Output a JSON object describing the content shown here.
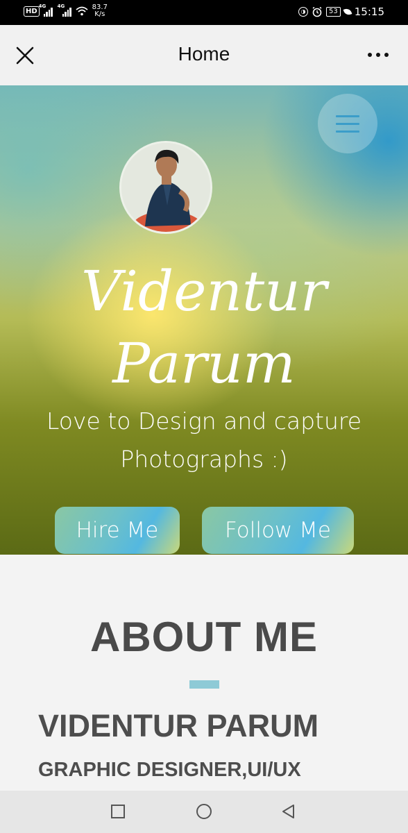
{
  "status_bar": {
    "hd_badge": "HD",
    "network_1": "4G",
    "network_2": "4G",
    "speed_value": "83.7",
    "speed_unit": "K/s",
    "battery": "53",
    "time": "15:15"
  },
  "app_bar": {
    "title": "Home",
    "close_icon": "close-icon",
    "more_icon": "more-horizontal-icon"
  },
  "hero": {
    "menu_icon": "hamburger-menu-icon",
    "name_line1": "Videntur",
    "name_line2": "Parum",
    "tagline_line1": "Love to Design and capture",
    "tagline_line2": "Photographs :)",
    "hire_button": "Hire Me",
    "follow_button": "Follow Me"
  },
  "about": {
    "title": "ABOUT ME",
    "name": "VIDENTUR PARUM",
    "role": "GRAPHIC DESIGNER,UI/UX"
  },
  "nav": {
    "recent_icon": "recent-apps-icon",
    "home_icon": "home-circle-icon",
    "back_icon": "back-triangle-icon"
  },
  "colors": {
    "accent": "#8ecad6",
    "heading": "#4a4a4a"
  }
}
